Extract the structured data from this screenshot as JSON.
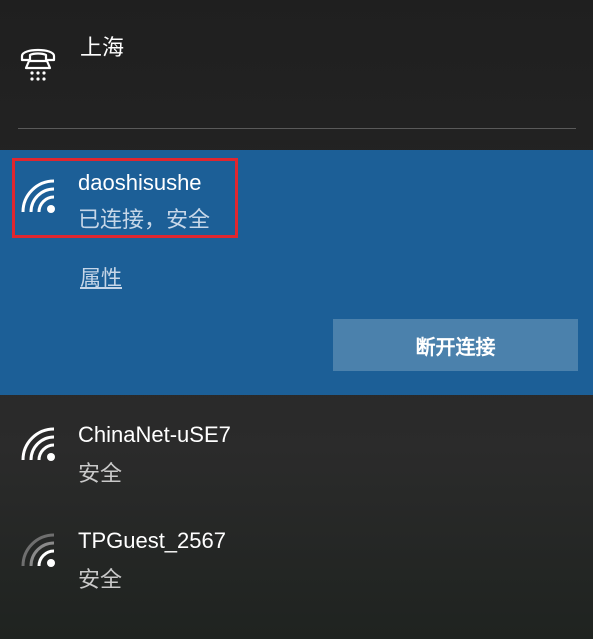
{
  "dialup": {
    "name": "上海",
    "icon": "dialup-phone-icon"
  },
  "connected_network": {
    "ssid": "daoshisushe",
    "status": "已连接，安全",
    "properties_label": "属性",
    "disconnect_label": "断开连接",
    "icon": "wifi-signal-icon"
  },
  "networks": [
    {
      "ssid": "ChinaNet-uSE7",
      "status": "安全",
      "icon": "wifi-signal-icon"
    },
    {
      "ssid": "TPGuest_2567",
      "status": "安全",
      "icon": "wifi-signal-weak-icon"
    }
  ],
  "colors": {
    "selected_bg": "#1c5f97",
    "button_bg": "#4b81ac",
    "highlight_border": "#e0262f"
  }
}
